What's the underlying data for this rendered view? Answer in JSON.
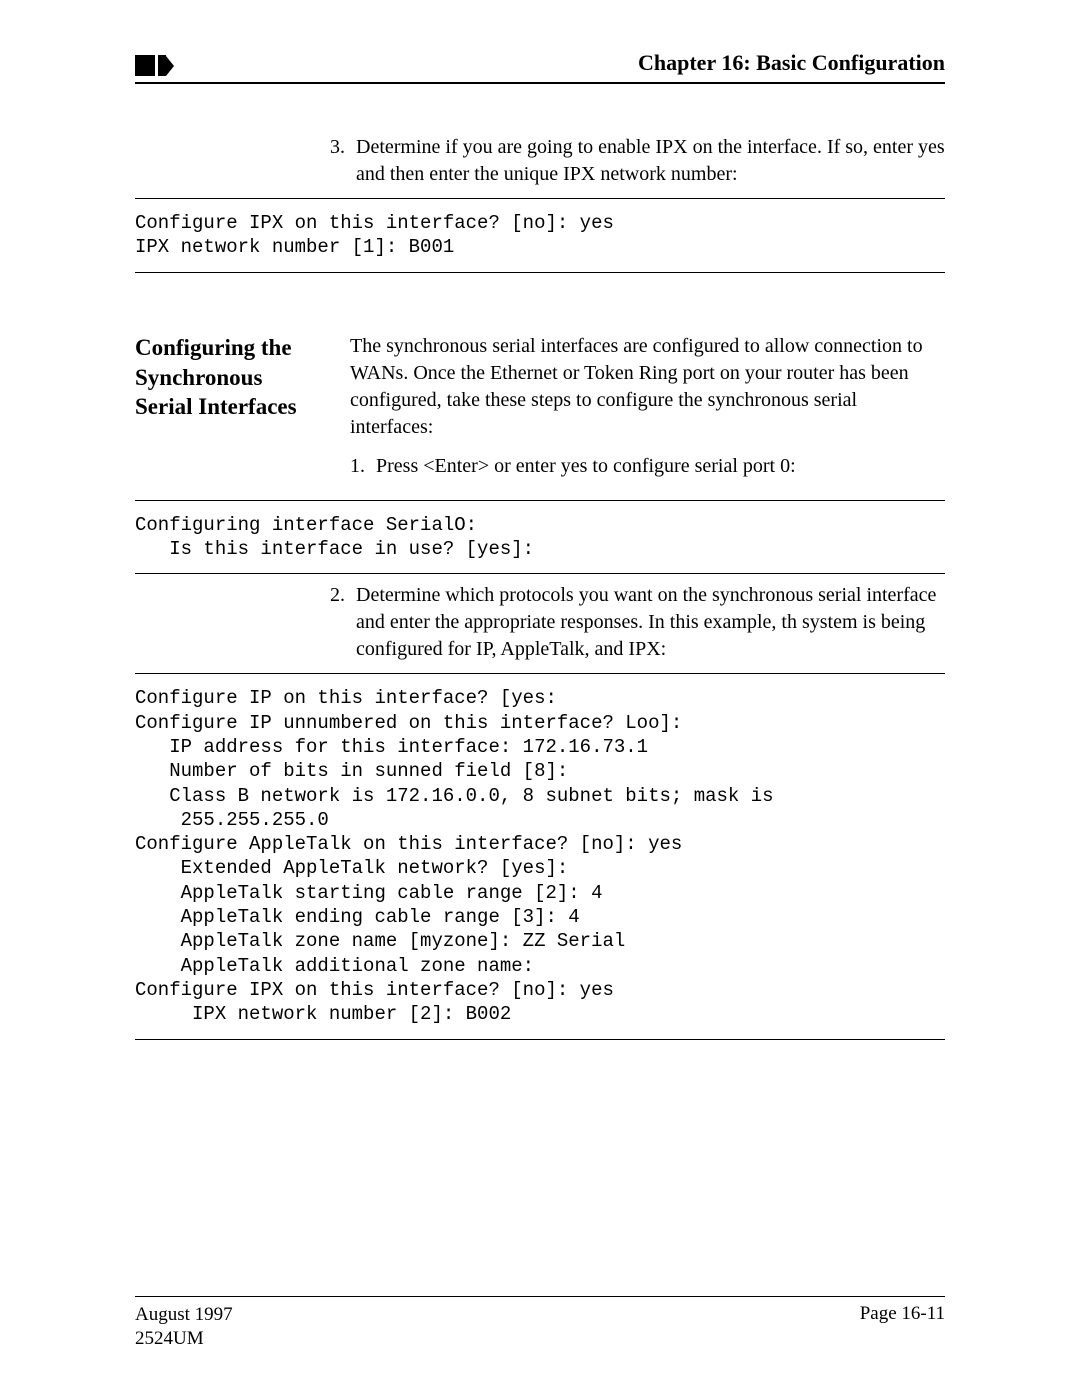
{
  "header": {
    "chapter_title": "Chapter 16: Basic Configuration"
  },
  "step3": {
    "num": "3.",
    "text": "Determine if you are going to enable IPX on the interface. If so, enter yes and then enter the unique IPX network number:"
  },
  "code1": "Configure IPX on this interface? [no]: yes\nIPX network number [1]: B001",
  "section": {
    "heading": "Configuring the Synchronous Serial Interfaces",
    "intro": "The synchronous serial interfaces are configured to allow connection to WANs. Once the Ethernet or Token Ring port on your router has been configured, take these steps to configure the synchronous serial interfaces:"
  },
  "step1": {
    "num": "1.",
    "text": "Press <Enter> or enter yes to configure serial port 0:"
  },
  "code2": "Configuring interface SerialO:\n   Is this interface in use? [yes]:",
  "step2": {
    "num": "2.",
    "text": "Determine which protocols you want on the synchronous serial interface and enter the appropriate responses. In this example, th system is being configured for IP, AppleTalk, and IPX:"
  },
  "code3": "Configure IP on this interface? [yes:\nConfigure IP unnumbered on this interface? Loo]:\n   IP address for this interface: 172.16.73.1\n   Number of bits in sunned field [8]:\n   Class B network is 172.16.0.0, 8 subnet bits; mask is\n    255.255.255.0\nConfigure AppleTalk on this interface? [no]: yes\n    Extended AppleTalk network? [yes]:\n    AppleTalk starting cable range [2]: 4\n    AppleTalk ending cable range [3]: 4\n    AppleTalk zone name [myzone]: ZZ Serial\n    AppleTalk additional zone name:\nConfigure IPX on this interface? [no]: yes\n     IPX network number [2]: B002",
  "footer": {
    "date": "August 1997",
    "doc": "2524UM",
    "page": "Page 16-11"
  }
}
